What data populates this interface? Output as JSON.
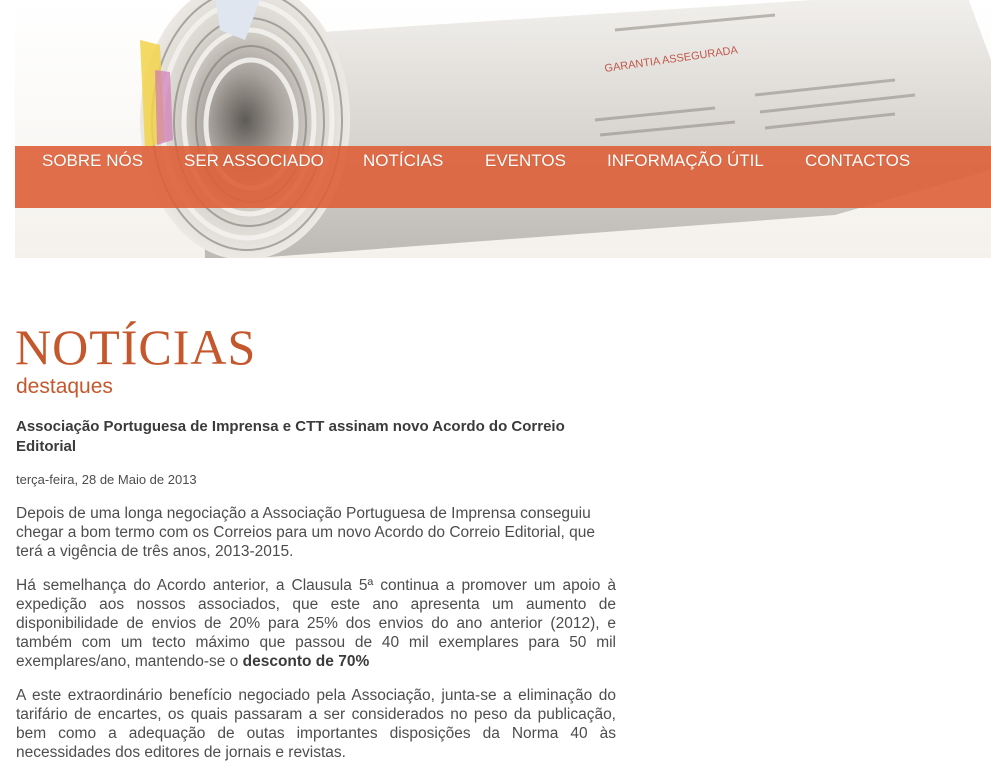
{
  "nav": {
    "items": [
      {
        "label": "SOBRE NÓS"
      },
      {
        "label": "SER ASSOCIADO"
      },
      {
        "label": "NOTÍCIAS"
      },
      {
        "label": "EVENTOS"
      },
      {
        "label": "INFORMAÇÃO ÚTIL"
      },
      {
        "label": "CONTACTOS"
      }
    ]
  },
  "section": {
    "title": "NOTÍCIAS",
    "subtitle": "destaques"
  },
  "article": {
    "title": "Associação Portuguesa de Imprensa e CTT assinam novo Acordo do Correio Editorial",
    "date": "terça-feira, 28 de Maio de 2013",
    "paragraph1": "Depois de uma longa negociação a Associação Portuguesa de Imprensa conseguiu chegar a bom termo com os Correios para um novo Acordo do Correio Editorial, que terá a vigência de três anos, 2013-2015.",
    "paragraph2_text": "Há semelhança do Acordo anterior, a Clausula 5ª continua a promover um apoio à expedição aos nossos associados, que este ano apresenta um aumento de disponibilidade de envios de 20% para 25% dos envios do ano anterior (2012), e também com um tecto máximo que passou de 40 mil exemplares para 50 mil exemplares/ano, mantendo-se o ",
    "paragraph2_bold": "desconto de 70%",
    "paragraph3": "A este extraordinário benefício negociado pela Associação, junta-se a eliminação do tarifário de encartes, os quais passaram a ser considerados no peso da publicação, bem como a adequação de outas importantes disposições da Norma 40 às necessidades dos editores de jornais e revistas."
  },
  "colors": {
    "accent": "#c5572d",
    "navbar": "#de5f38",
    "text": "#4d4d4d"
  },
  "banner": {
    "image": "rolled-newspaper"
  }
}
